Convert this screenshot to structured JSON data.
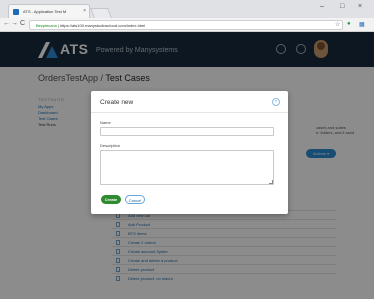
{
  "browser": {
    "tab_title": "ATS - Application Test M",
    "tab_close": "×",
    "window_minimize": "–",
    "window_maximize": "□",
    "window_close": "×",
    "secure_label": "Bezpieczna",
    "url": "https://ats100.manystudioscloud.com/index.html",
    "back_glyph": "←",
    "forward_glyph": "→",
    "reload_glyph": "C",
    "bookmark_glyph": "☆"
  },
  "app": {
    "logo": "ATS",
    "tagline": "Powered by Manysystems",
    "header_icons": [
      "help-icon",
      "settings-icon"
    ]
  },
  "page": {
    "breadcrumb_root": "OrdersTestApp",
    "breadcrumb_sep": " / ",
    "breadcrumb_current": "Test Cases",
    "side_heading": "TESTSUITE",
    "side_items": [
      "My Apps",
      "Dashboard",
      "Test Cases",
      "Test Runs"
    ],
    "hint_lines": [
      "cases and suites",
      "e: folders, and it used"
    ],
    "action_button": "Actions ▾",
    "list_items": [
      "Add new cat",
      "Add Product",
      "BTS items",
      "Create 2 orders",
      "Create account Spider",
      "Create and delete a product",
      "Delete product",
      "Delete product, no macro"
    ]
  },
  "modal": {
    "title": "Create new",
    "close_glyph": "×",
    "name_label": "Name",
    "name_value": "",
    "description_label": "Description",
    "description_value": "",
    "create_label": "Create",
    "cancel_label": "Cancel"
  },
  "colors": {
    "header_bg": "#182b3c",
    "accent": "#2a8ad4",
    "create_green": "#2e8b2e"
  }
}
